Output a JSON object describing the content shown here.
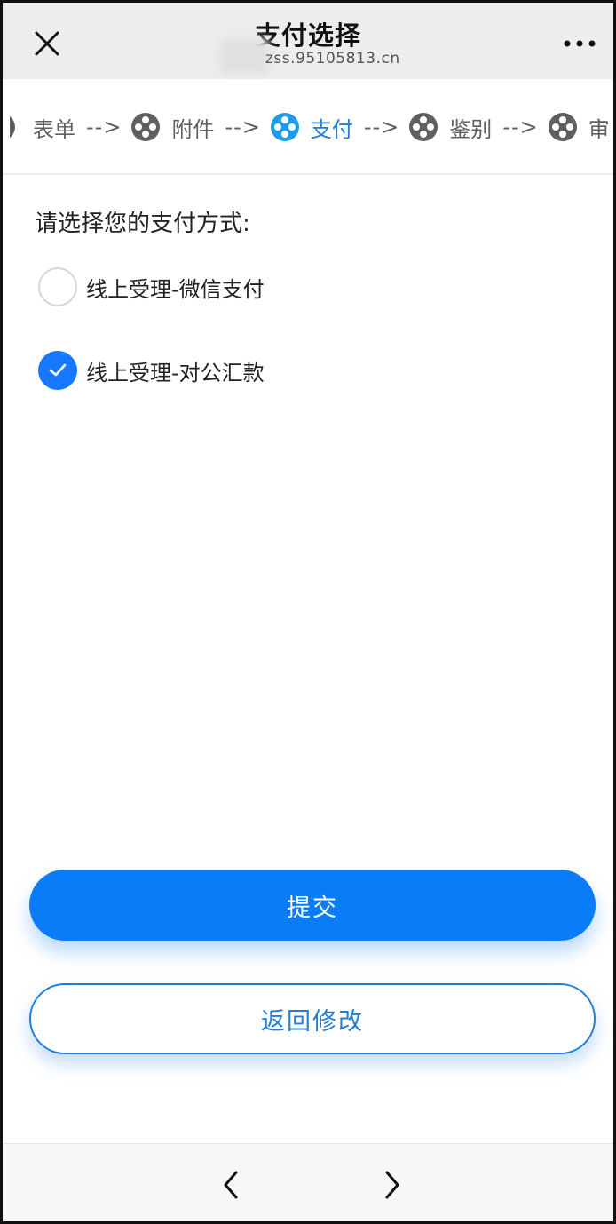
{
  "topbar": {
    "title": "支付选择",
    "url": "zss.95105813.cn",
    "close_icon": "close-icon",
    "more_icon": "more-icon"
  },
  "steps": {
    "items": [
      {
        "label": "表单",
        "active": false
      },
      {
        "label": "附件",
        "active": false
      },
      {
        "label": "支付",
        "active": true
      },
      {
        "label": "鉴别",
        "active": false
      },
      {
        "label": "审",
        "active": false
      }
    ],
    "arrow": "-->",
    "active_color": "#1f7fd6",
    "inactive_color": "#5f5f5f"
  },
  "payment": {
    "prompt": "请选择您的支付方式:",
    "options": [
      {
        "label": "线上受理-微信支付",
        "checked": false
      },
      {
        "label": "线上受理-对公汇款",
        "checked": true
      }
    ]
  },
  "actions": {
    "submit_label": "提交",
    "back_label": "返回修改",
    "primary_color": "#0b7cf7"
  },
  "bottom_nav": {
    "back_icon": "chevron-left-icon",
    "forward_icon": "chevron-right-icon"
  }
}
